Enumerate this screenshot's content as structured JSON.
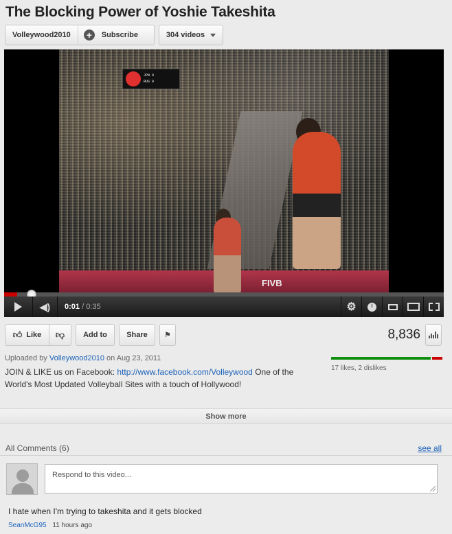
{
  "video": {
    "title": "The Blocking Power of Yoshie Takeshita",
    "progress_fraction": 0.029
  },
  "channel": {
    "name": "Volleywood2010",
    "subscribe_label": "Subscribe",
    "videos_label": "304 videos"
  },
  "player": {
    "current_time": "0:01",
    "duration": "/ 0:35",
    "scoreboard_line1": "JPN 0",
    "scoreboard_line2": "RUS 0",
    "board_text": "FIVB",
    "icons": [
      "play-icon",
      "volume-icon",
      "gear-icon",
      "clock-icon",
      "small-player-icon",
      "large-player-icon",
      "fullscreen-icon"
    ]
  },
  "actions": {
    "like_label": "Like",
    "add_to_label": "Add to",
    "share_label": "Share",
    "view_count": "8,836"
  },
  "info": {
    "uploaded_prefix": "Uploaded by",
    "uploader": "Volleywood2010",
    "uploaded_date": "on Aug 23, 2011",
    "desc_prefix": "JOIN & LIKE us on Facebook:",
    "desc_link": "http://www.facebook.com/Volleywood",
    "desc_suffix": "One of the World's Most Updated Volleyball Sites with a touch of Hollywood!",
    "likes_text": "17 likes, 2 dislikes",
    "like_fraction": 0.895,
    "show_more": "Show more"
  },
  "comments": {
    "header": "All Comments (6)",
    "see_all": "see all",
    "reply_placeholder": "Respond to this video...",
    "items": [
      {
        "text": "I hate when I'm trying to takeshita and it gets blocked",
        "author": "SeanMcG95",
        "when": "11 hours ago"
      }
    ]
  },
  "colors": {
    "like_green": "#0e8f0e",
    "dislike_red": "#c00000",
    "link_blue": "#1c62b9",
    "progress_red": "#cc0000"
  }
}
